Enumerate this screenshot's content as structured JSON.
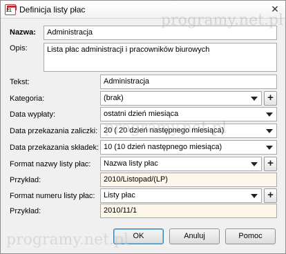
{
  "window": {
    "title": "Definicja listy płac",
    "close_glyph": "✕"
  },
  "form": {
    "nazwa": {
      "label": "Nazwa:",
      "value": "Administracja"
    },
    "opis": {
      "label": "Opis:",
      "value": "Lista płac administracji i pracowników biurowych"
    },
    "tekst": {
      "label": "Tekst:",
      "value": "Administracja"
    },
    "kategoria": {
      "label": "Kategoria:",
      "value": "(brak)"
    },
    "data_wyplaty": {
      "label": "Data wypłaty:",
      "value": "ostatni dzień miesiąca"
    },
    "data_zaliczki": {
      "label": "Data przekazania zaliczki:",
      "value": "20 ( 20 dzień następnego miesiąca)"
    },
    "data_skladek": {
      "label": "Data przekazania składek:",
      "value": "10 (10 dzień następnego miesiąca)"
    },
    "format_nazwy": {
      "label": "Format nazwy listy płac:",
      "value": "Nazwa listy płac"
    },
    "przyklad1": {
      "label": "Przykład:",
      "value": "2010/Listopad/(LP)"
    },
    "format_numeru": {
      "label": "Format numeru listy płac:",
      "value": "Listy płac"
    },
    "przyklad2": {
      "label": "Przykład:",
      "value": "2010/11/1"
    },
    "plus_glyph": "+"
  },
  "buttons": {
    "ok": "OK",
    "cancel": "Anuluj",
    "help": "Pomoc"
  },
  "watermark": "programy.net.pl",
  "colors": {
    "readonly_bg": "#fdf6ea",
    "window_bg": "#f0f0f0",
    "default_border": "#3c7fb1"
  }
}
